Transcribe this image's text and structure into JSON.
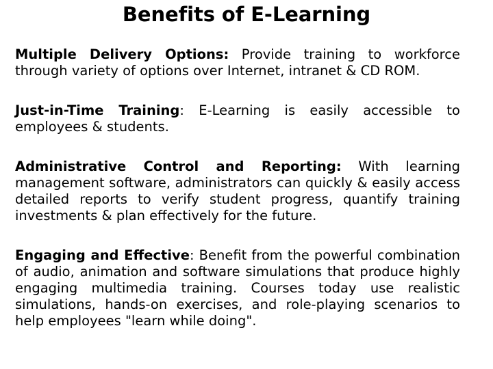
{
  "slide": {
    "title": "Benefits of E-Learning",
    "text_color": "#000000",
    "background_color": "#ffffff",
    "paragraphs": [
      {
        "lead": "Multiple Delivery Options",
        "lead_colon": ":",
        "lead_colon_bold": true,
        "body": "  Provide training to workforce through variety of options over Internet, intranet & CD ROM."
      },
      {
        "lead": "Just-in-Time Training",
        "lead_colon": ":",
        "lead_colon_bold": false,
        "body": " E-Learning is easily accessible to employees & students."
      },
      {
        "lead": "Administrative Control and Reporting",
        "lead_colon": ":",
        "lead_colon_bold": true,
        "body": " With learning management software, administrators can quickly & easily access detailed reports to verify student progress, quantify training investments & plan effectively for the future."
      },
      {
        "lead": "Engaging and Effective",
        "lead_colon": ":",
        "lead_colon_bold": false,
        "body": " Benefit from the powerful combination of audio, animation and software simulations that produce highly engaging multimedia training. Courses today use realistic simulations, hands-on exercises, and role-playing scenarios to help employees \"learn while doing\"."
      }
    ]
  }
}
